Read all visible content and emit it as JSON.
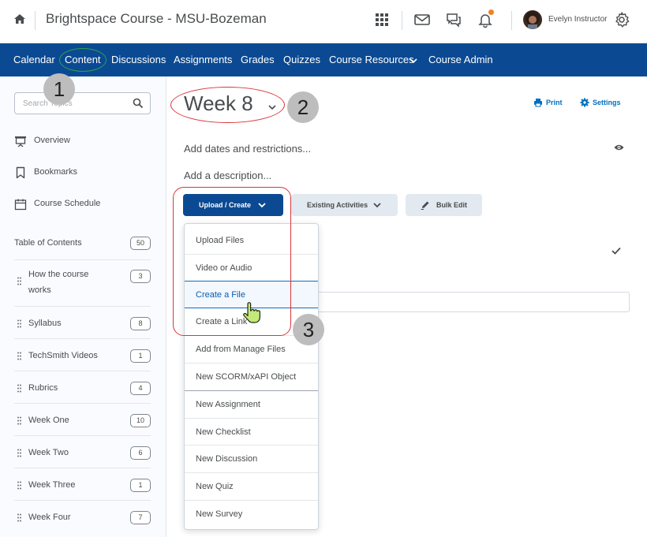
{
  "header": {
    "course_title": "Brightspace Course - MSU-Bozeman",
    "user_name": "Evelyn Instructor",
    "icons": [
      "home-icon",
      "apps-grid-icon",
      "mail-icon",
      "chat-icon",
      "bell-icon",
      "gear-icon"
    ]
  },
  "nav": {
    "items": [
      {
        "label": "Calendar"
      },
      {
        "label": "Content"
      },
      {
        "label": "Discussions"
      },
      {
        "label": "Assignments"
      },
      {
        "label": "Grades"
      },
      {
        "label": "Quizzes"
      },
      {
        "label": "Course Resources"
      },
      {
        "label": "Course Admin"
      }
    ]
  },
  "sidebar": {
    "search_placeholder": "Search Topics",
    "links": [
      {
        "label": "Overview",
        "icon": "presentation-icon"
      },
      {
        "label": "Bookmarks",
        "icon": "bookmark-icon"
      },
      {
        "label": "Course Schedule",
        "icon": "calendar-icon"
      }
    ],
    "toc_label": "Table of Contents",
    "toc_count": "50",
    "toc_items": [
      {
        "line1": "How the course",
        "line2": "works",
        "count": "3"
      },
      {
        "label": "Syllabus",
        "count": "8"
      },
      {
        "label": "TechSmith Videos",
        "count": "1"
      },
      {
        "label": "Rubrics",
        "count": "4"
      },
      {
        "label": "Week One",
        "count": "10"
      },
      {
        "label": "Week Two",
        "count": "6"
      },
      {
        "label": "Week Three",
        "count": "1"
      },
      {
        "label": "Week Four",
        "count": "7"
      }
    ]
  },
  "main": {
    "week_title": "Week 8",
    "print_label": "Print",
    "settings_label": "Settings",
    "dates_text": "Add dates and restrictions...",
    "description_text": "Add a description...",
    "buttons": {
      "upload_create": "Upload / Create",
      "existing_activities": "Existing Activities",
      "bulk_edit": "Bulk Edit"
    },
    "dropdown_items": [
      "Upload Files",
      "Video or Audio",
      "Create a File",
      "Create a Link",
      "Add from Manage Files",
      "New SCORM/xAPI Object",
      "New Assignment",
      "New Checklist",
      "New Discussion",
      "New Quiz",
      "New Survey"
    ],
    "highlighted_item": "Create a File"
  },
  "callouts": [
    "1",
    "2",
    "3"
  ],
  "colors": {
    "nav_bg": "#0b4a93",
    "link": "#006fbf",
    "annotation_red": "#d9363b",
    "annotation_green": "#2aa34a",
    "callout_gray": "#bdbdbd"
  }
}
